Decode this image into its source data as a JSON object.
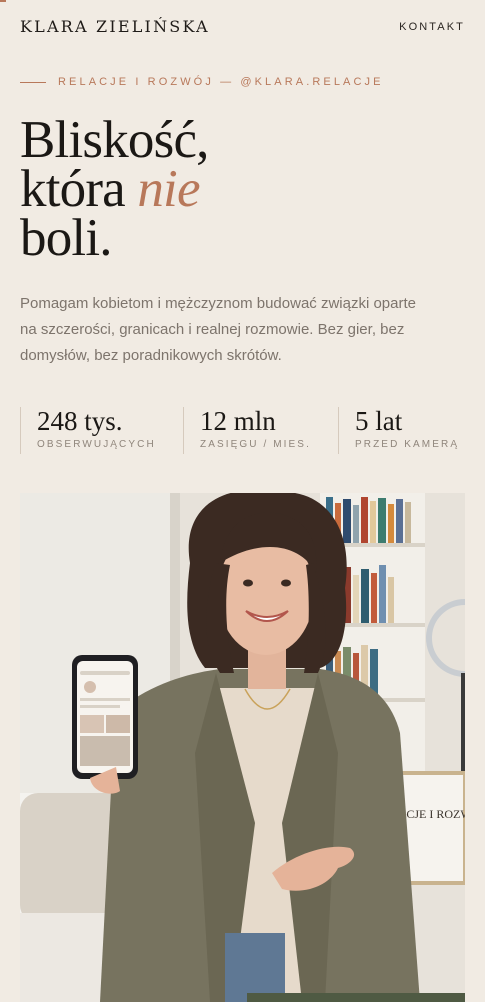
{
  "header": {
    "brand": "KLARA ZIELIŃSKA",
    "nav_contact": "KONTAKT"
  },
  "eyebrow": "RELACJE I ROZWÓJ — @KLARA.RELACJE",
  "hero": {
    "line1": "Bliskość,",
    "line2_start": "która ",
    "line2_accent": "nie",
    "line3": "boli."
  },
  "lead": "Pomagam kobietom i mężczyznom budować związki oparte na szczerości, granicach i realnej rozmowie. Bez gier, bez domysłów, bez poradnikowych skrótów.",
  "stats": [
    {
      "value": "248 tys.",
      "label": "OBSERWUJĄCYCH"
    },
    {
      "value": "12 mln",
      "label": "ZASIĘGU / MIES."
    },
    {
      "value": "5 lat",
      "label": "PRZED KAMERĄ"
    }
  ],
  "photo": {
    "sign_text": "RELACJE I ROZWÓJ"
  },
  "colors": {
    "background": "#f1ebe3",
    "accent": "#b8785a",
    "text": "#1d1a17",
    "muted": "#7d746c",
    "cta": "#4f5a43"
  }
}
